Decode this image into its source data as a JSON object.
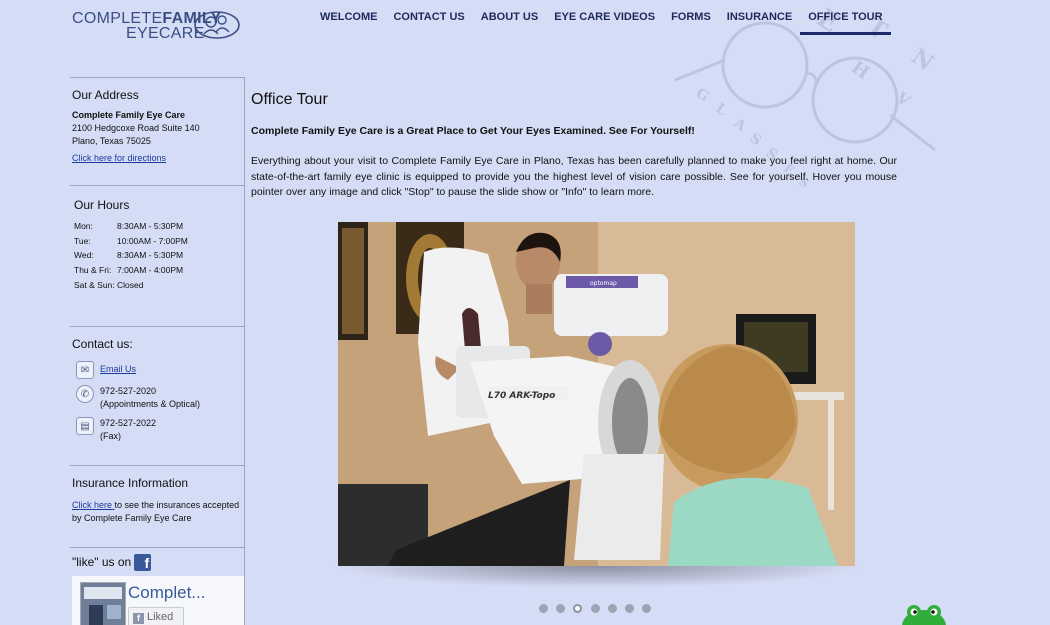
{
  "brand": {
    "line1_light": "COMPLETE",
    "line1_bold": "FAMILY",
    "line2": "EYECARE"
  },
  "nav": {
    "items": [
      {
        "label": "WELCOME"
      },
      {
        "label": "CONTACT US"
      },
      {
        "label": "ABOUT US"
      },
      {
        "label": "EYE CARE VIDEOS"
      },
      {
        "label": "FORMS"
      },
      {
        "label": "INSURANCE"
      },
      {
        "label": "OFFICE TOUR"
      }
    ],
    "active": "OFFICE TOUR"
  },
  "address": {
    "heading": "Our Address",
    "name": "Complete Family Eye Care",
    "street": "2100 Hedgcoxe Road Suite 140",
    "city": "Plano, Texas 75025",
    "directions_link": "Click here for directions"
  },
  "hours": {
    "heading": "Our Hours",
    "rows": [
      {
        "day": "Mon:",
        "time": "8:30AM - 5:30PM"
      },
      {
        "day": "Tue:",
        "time": "10:00AM - 7:00PM"
      },
      {
        "day": "Wed:",
        "time": "8:30AM - 5:30PM"
      },
      {
        "day": "Thu & Fri:",
        "time": "7:00AM - 4:00PM"
      },
      {
        "day": "Sat & Sun:",
        "time": "Closed"
      }
    ]
  },
  "contact": {
    "heading": "Contact us:",
    "email_label": "Email Us",
    "phone1": "972-527-2020",
    "phone1_note": "(Appointments & Optical)",
    "phone2": "972-527-2022",
    "phone2_note": "(Fax)",
    "icons": [
      "email-icon",
      "phone-icon",
      "fax-icon"
    ]
  },
  "insurance": {
    "heading": "Insurance Information",
    "link": "Click here ",
    "text": "to see the insurances accepted by Complete Family Eye Care"
  },
  "facebook": {
    "heading": "\"like\" us on",
    "page_name": "Complet...",
    "liked_label": "Liked",
    "logo_letter": "f"
  },
  "main": {
    "title": "Office Tour",
    "subtitle": "Complete Family Eye Care is a Great Place to Get Your Eyes Examined. See For Yourself!",
    "paragraph": "Everything about your visit to Complete Family Eye Care in Plano, Texas has been carefully planned to make you feel right at home. Our state-of-the-art family eye clinic is equipped to provide you the highest level of vision care possible. See for yourself. Hover you mouse pointer over any image and click \"Stop\" to pause the slide show or \"Info\" to learn more."
  },
  "slideshow": {
    "dot_count": 7,
    "active_index": 2,
    "machine_label": "L70 ARK-Topo",
    "device_label": "optomap"
  },
  "colors": {
    "background": "#d5dcf5",
    "nav_text": "#1c2a5a",
    "brand": "#3a4f86",
    "link": "#1b3a9e",
    "facebook": "#3b5998"
  }
}
